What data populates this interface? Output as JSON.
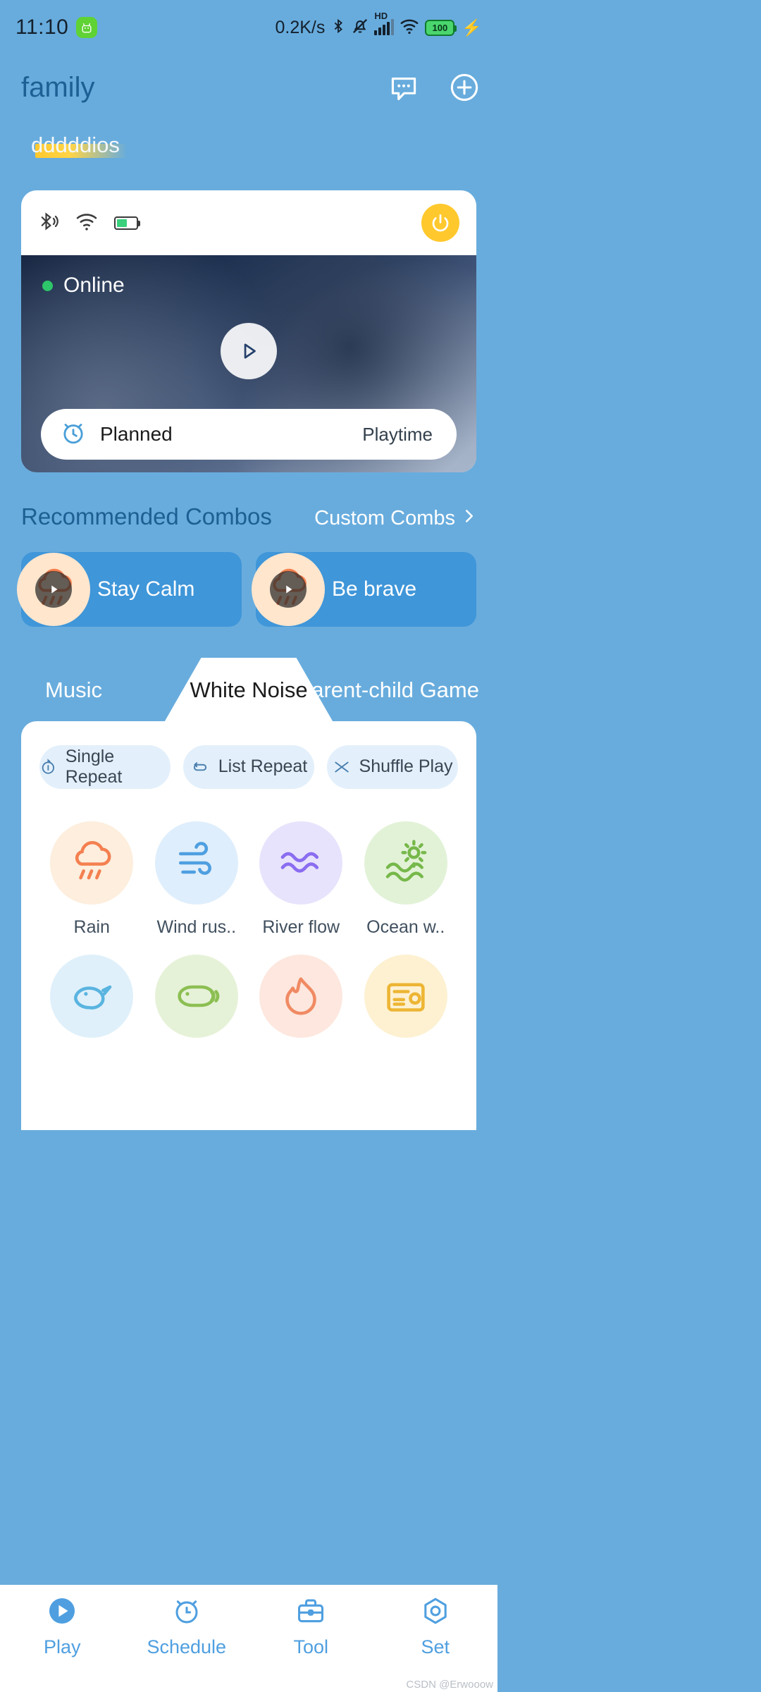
{
  "statusbar": {
    "time": "11:10",
    "robot_icon": "android-robot-icon",
    "net_speed": "0.2K/s",
    "bluetooth_icon": "bluetooth-icon",
    "mute_icon": "bell-muted-icon",
    "hd_label": "HD",
    "signal_icon": "signal-bars-icon",
    "wifi_icon": "wifi-icon",
    "battery_level": "100",
    "charging_icon": "charging-bolt-icon"
  },
  "header": {
    "title": "family",
    "message_icon": "chat-bubble-icon",
    "add_icon": "plus-circle-icon"
  },
  "device_tabs": [
    {
      "label": "dddddios",
      "active": true
    }
  ],
  "device_card": {
    "status_icons": [
      "bluetooth-icon",
      "wifi-icon",
      "battery-charging-icon"
    ],
    "power_icon": "power-icon",
    "online_label": "Online",
    "online_color": "#2ec66a",
    "play_icon": "play-icon",
    "planned": {
      "alarm_icon": "alarm-clock-icon",
      "label": "Planned",
      "value": "Playtime"
    }
  },
  "recommended": {
    "title": "Recommended Combos",
    "more_label": "Custom Combs",
    "chevron_icon": "chevron-right-icon",
    "items": [
      {
        "label": "Stay Calm",
        "icon": "rain-cloud-icon",
        "play_icon": "play-icon"
      },
      {
        "label": "Be brave",
        "icon": "rain-cloud-icon",
        "play_icon": "play-icon"
      }
    ]
  },
  "content_tabs": [
    {
      "label": "Music",
      "active": false
    },
    {
      "label": "White Noise",
      "active": true
    },
    {
      "label": "Parent-child Game",
      "active": false
    }
  ],
  "play_modes": [
    {
      "label": "Single Repeat",
      "icon": "repeat-one-icon"
    },
    {
      "label": "List Repeat",
      "icon": "repeat-list-icon"
    },
    {
      "label": "Shuffle Play",
      "icon": "shuffle-icon"
    }
  ],
  "sounds": [
    {
      "label": "Rain",
      "icon": "rain-cloud-icon",
      "bg": "#fdeedd",
      "fg": "#f48050"
    },
    {
      "label": "Wind rus..",
      "icon": "wind-icon",
      "bg": "#dfeefc",
      "fg": "#4e9fe0"
    },
    {
      "label": "River flow",
      "icon": "waves-icon",
      "bg": "#e8e3fc",
      "fg": "#8a6df0"
    },
    {
      "label": "Ocean w..",
      "icon": "sunset-waves-icon",
      "bg": "#e2f2d7",
      "fg": "#76b84a"
    },
    {
      "label": "",
      "icon": "bird-icon",
      "bg": "#dff0fa",
      "fg": "#5ab4e0"
    },
    {
      "label": "",
      "icon": "whale-icon",
      "bg": "#e6f2d8",
      "fg": "#8cbf52"
    },
    {
      "label": "",
      "icon": "flame-icon",
      "bg": "#fde7de",
      "fg": "#f08a63"
    },
    {
      "label": "",
      "icon": "radio-icon",
      "bg": "#fdf1d2",
      "fg": "#edb534"
    }
  ],
  "bottom_nav": [
    {
      "label": "Play",
      "icon": "play-circle-icon",
      "active": true
    },
    {
      "label": "Schedule",
      "icon": "alarm-clock-icon",
      "active": false
    },
    {
      "label": "Tool",
      "icon": "toolbox-icon",
      "active": false
    },
    {
      "label": "Set",
      "icon": "gear-hex-icon",
      "active": false
    }
  ],
  "watermark": "CSDN @Erwooow",
  "colors": {
    "page_bg": "#68acdd",
    "accent": "#3f96d9",
    "title": "#1d6094",
    "power": "#ffc82c"
  }
}
